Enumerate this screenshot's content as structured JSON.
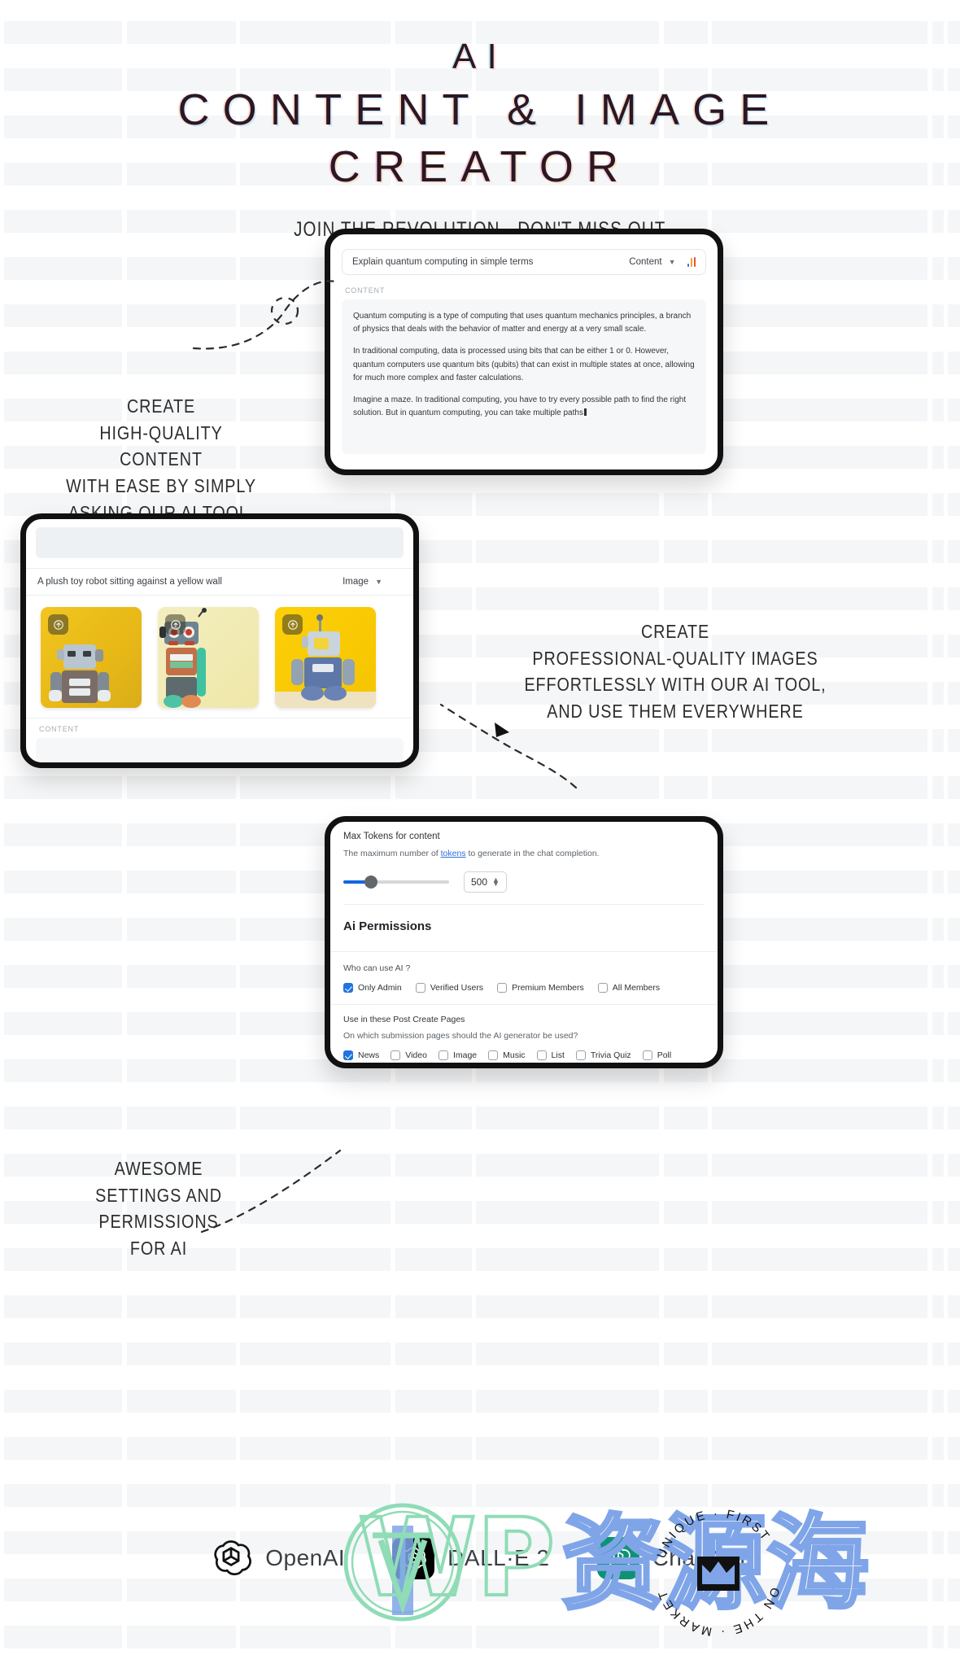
{
  "hero": {
    "line1": "AI",
    "line2": "CONTENT & IMAGE",
    "line3": "CREATOR",
    "tagline": "JOIN THE REVOLUTION - DON'T MISS OUT",
    "underline_color": "#79c5c9"
  },
  "callouts": {
    "content": "CREATE\nHIGH-QUALITY CONTENT\nWITH EASE BY SIMPLY\nASKING OUR AI TOOL.",
    "content_lines": [
      "CREATE",
      "HIGH-QUALITY CONTENT",
      "WITH EASE BY SIMPLY",
      "ASKING OUR AI TOOL."
    ],
    "images_lines": [
      "CREATE",
      "PROFESSIONAL-QUALITY IMAGES",
      "EFFORTLESSLY WITH OUR AI TOOL,",
      "AND USE THEM EVERYWHERE"
    ],
    "settings_lines": [
      "AWESOME",
      "SETTINGS AND PERMISSIONS",
      "FOR AI"
    ]
  },
  "tablet_content": {
    "prompt_value": "Explain quantum computing in simple terms",
    "type_selected": "Content",
    "section_label": "CONTENT",
    "paragraphs": [
      "Quantum computing is a type of computing that uses quantum mechanics principles, a branch of physics that deals with the behavior of matter and energy at a very small scale.",
      "In traditional computing, data is processed using bits that can be either 1 or 0. However, quantum computers use quantum bits (qubits) that can exist in multiple states at once, allowing for much more complex and faster calculations.",
      "Imagine a maze. In traditional computing, you have to try every possible path to find the right solution. But in quantum computing, you can take multiple paths"
    ]
  },
  "tablet_image": {
    "prompt_value": "A plush toy robot sitting against a yellow wall",
    "type_selected": "Image",
    "section_label": "CONTENT",
    "cards": [
      {
        "name": "robot-card-1",
        "upload_icon": "upload-icon"
      },
      {
        "name": "robot-card-2",
        "upload_icon": "upload-icon"
      },
      {
        "name": "robot-card-3",
        "upload_icon": "upload-icon"
      }
    ]
  },
  "settings": {
    "max_tokens_title": "Max Tokens for content",
    "max_tokens_desc_before": "The maximum number of ",
    "max_tokens_link": "tokens",
    "max_tokens_desc_after": " to generate in the chat completion.",
    "max_tokens_value": "500",
    "slider_percent": 20,
    "permissions_heading": "Ai Permissions",
    "who_label": "Who can use AI ?",
    "who_options": [
      {
        "label": "Only Admin",
        "checked": true
      },
      {
        "label": "Verified Users",
        "checked": false
      },
      {
        "label": "Premium Members",
        "checked": false
      },
      {
        "label": "All Members",
        "checked": false
      }
    ],
    "pages_title": "Use in these Post Create Pages",
    "pages_desc": "On which submission pages should the AI generator be used?",
    "pages_options": [
      {
        "label": "News",
        "checked": true
      },
      {
        "label": "Video",
        "checked": false
      },
      {
        "label": "Image",
        "checked": false
      },
      {
        "label": "Music",
        "checked": false
      },
      {
        "label": "List",
        "checked": false
      },
      {
        "label": "Trivia Quiz",
        "checked": false
      },
      {
        "label": "Poll",
        "checked": false
      }
    ]
  },
  "footer": {
    "brands": [
      {
        "name": "OpenAI",
        "logo": "openai-logo"
      },
      {
        "name": "DALL·E 2",
        "logo": "openai-square-logo"
      },
      {
        "name": "ChatGPT",
        "logo": "chatgpt-green-logo"
      }
    ]
  },
  "watermark": {
    "text": "WP资源海",
    "badge_text": "MARKET · UNIQUE · FIRST ON THE",
    "color_green": "#8fdcb6",
    "color_blue": "#7fa5e8"
  }
}
